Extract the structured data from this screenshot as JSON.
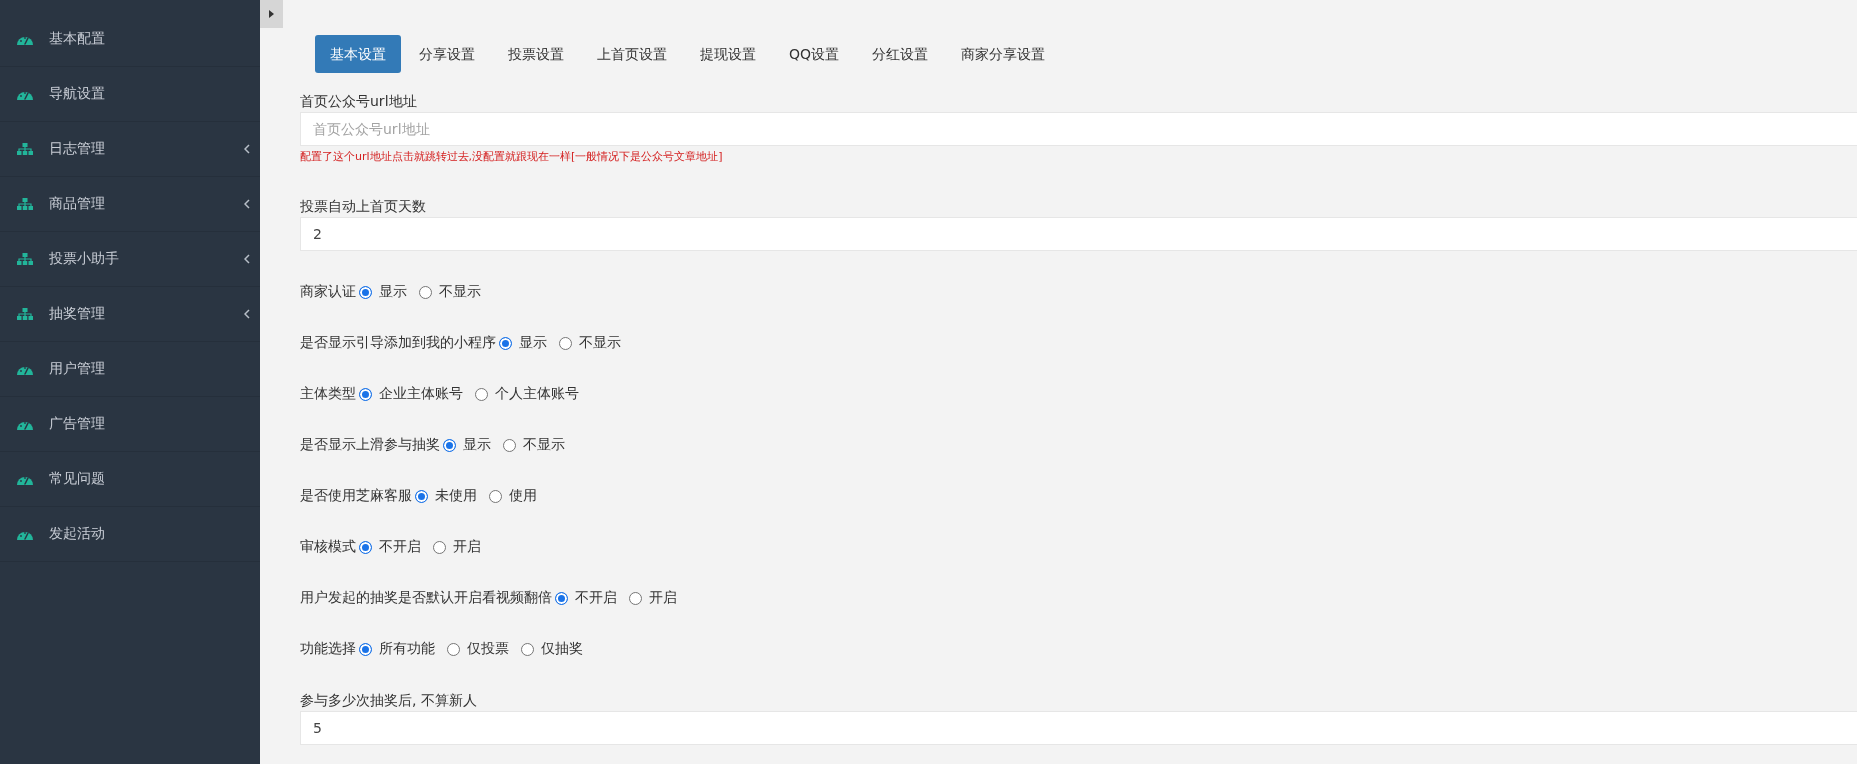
{
  "sidebar": {
    "items": [
      {
        "label": "基本配置",
        "kind": "page",
        "selected": false
      },
      {
        "label": "导航设置",
        "kind": "page",
        "selected": false
      },
      {
        "label": "日志管理",
        "kind": "group",
        "expanded": false,
        "selected": false
      },
      {
        "label": "商品管理",
        "kind": "group",
        "expanded": false,
        "selected": false
      },
      {
        "label": "投票小助手",
        "kind": "group",
        "expanded": false,
        "selected": false
      },
      {
        "label": "抽奖管理",
        "kind": "group",
        "expanded": false,
        "selected": false
      },
      {
        "label": "用户管理",
        "kind": "page",
        "selected": false
      },
      {
        "label": "广告管理",
        "kind": "page",
        "selected": false
      },
      {
        "label": "常见问题",
        "kind": "page",
        "selected": false
      },
      {
        "label": "发起活动",
        "kind": "page",
        "selected": false
      }
    ]
  },
  "tabs": [
    {
      "label": "基本设置",
      "selected": true
    },
    {
      "label": "分享设置",
      "selected": false
    },
    {
      "label": "投票设置",
      "selected": false
    },
    {
      "label": "上首页设置",
      "selected": false
    },
    {
      "label": "提现设置",
      "selected": false
    },
    {
      "label": "QQ设置",
      "selected": false
    },
    {
      "label": "分红设置",
      "selected": false
    },
    {
      "label": "商家分享设置",
      "selected": false
    }
  ],
  "form": {
    "fields": [
      {
        "kind": "text",
        "label": "首页公众号url地址",
        "placeholder": "首页公众号url地址",
        "hint": "配置了这个url地址点击就跳转过去,没配置就跟现在一样[一般情况下是公众号文章地址]"
      },
      {
        "kind": "text",
        "label": "投票自动上首页天数",
        "value": "2"
      },
      {
        "kind": "radio",
        "label": "商家认证",
        "options": [
          {
            "label": "显示",
            "selected": true
          },
          {
            "label": "不显示",
            "selected": false
          }
        ]
      },
      {
        "kind": "radio",
        "label": "是否显示引导添加到我的小程序",
        "options": [
          {
            "label": "显示",
            "selected": true
          },
          {
            "label": "不显示",
            "selected": false
          }
        ]
      },
      {
        "kind": "radio",
        "label": "主体类型",
        "options": [
          {
            "label": "企业主体账号",
            "selected": true
          },
          {
            "label": "个人主体账号",
            "selected": false
          }
        ]
      },
      {
        "kind": "radio",
        "label": "是否显示上滑参与抽奖",
        "options": [
          {
            "label": "显示",
            "selected": true
          },
          {
            "label": "不显示",
            "selected": false
          }
        ]
      },
      {
        "kind": "radio",
        "label": "是否使用芝麻客服",
        "options": [
          {
            "label": "未使用",
            "selected": true
          },
          {
            "label": "使用",
            "selected": false
          }
        ]
      },
      {
        "kind": "radio",
        "label": "审核模式",
        "options": [
          {
            "label": "不开启",
            "selected": true
          },
          {
            "label": "开启",
            "selected": false
          }
        ]
      },
      {
        "kind": "radio",
        "label": "用户发起的抽奖是否默认开启看视频翻倍",
        "options": [
          {
            "label": "不开启",
            "selected": true
          },
          {
            "label": "开启",
            "selected": false
          }
        ]
      },
      {
        "kind": "radio",
        "label": "功能选择",
        "options": [
          {
            "label": "所有功能",
            "selected": true
          },
          {
            "label": "仅投票",
            "selected": false
          },
          {
            "label": "仅抽奖",
            "selected": false
          }
        ]
      },
      {
        "kind": "text",
        "label": "参与多少次抽奖后, 不算新人",
        "value": "5"
      }
    ]
  }
}
